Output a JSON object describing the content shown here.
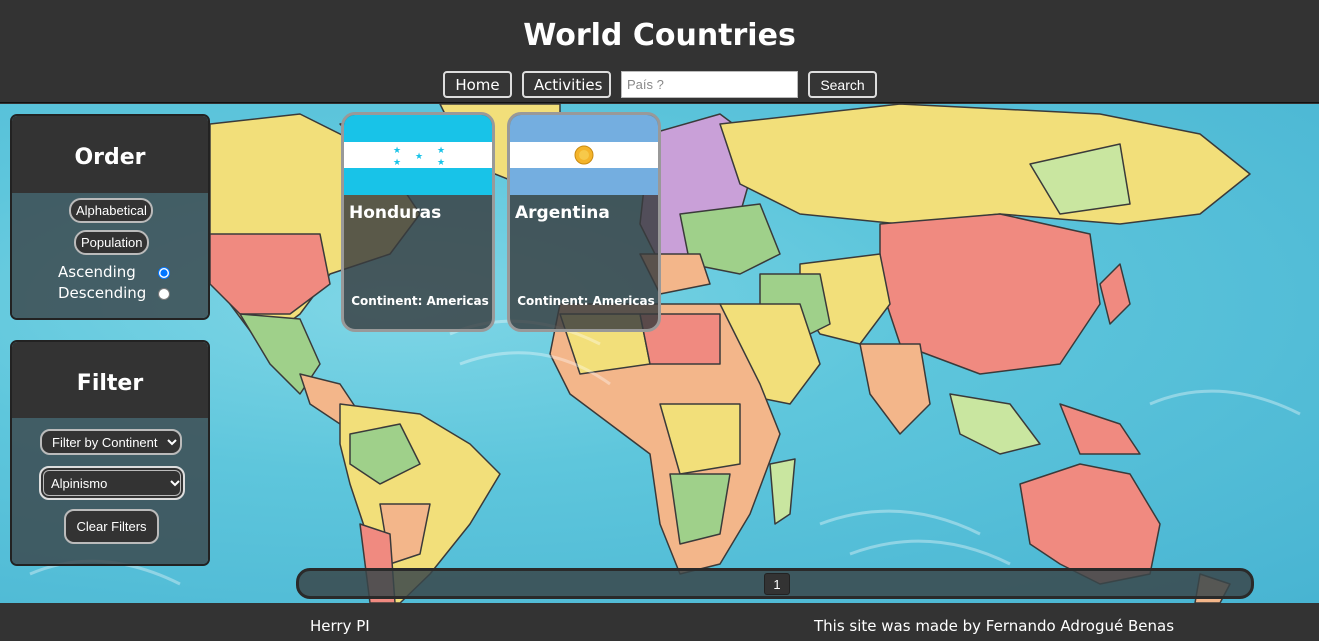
{
  "header": {
    "title": "World Countries",
    "nav": {
      "home_label": "Home",
      "activities_label": "Activities",
      "search_label": "Search"
    },
    "search": {
      "placeholder": "País ?",
      "value": ""
    }
  },
  "order_panel": {
    "title": "Order",
    "alphabetical_label": "Alphabetical",
    "population_label": "Population",
    "ascending_label": "Ascending",
    "descending_label": "Descending",
    "selected_direction": "Ascending"
  },
  "filter_panel": {
    "title": "Filter",
    "continent_selected": "Filter by Continent",
    "activity_selected": "Alpinismo",
    "clear_label": "Clear Filters"
  },
  "cards": [
    {
      "name": "Honduras",
      "continent_label": "Continent:",
      "continent": "Americas",
      "flag": "honduras-flag"
    },
    {
      "name": "Argentina",
      "continent_label": "Continent:",
      "continent": "Americas",
      "flag": "argentina-flag"
    }
  ],
  "pagination": {
    "current_page": "1"
  },
  "footer": {
    "left": "Herry PI",
    "right": "This site was made by Fernando Adrogué Benas"
  },
  "colors": {
    "header_bg": "#333333",
    "ocean": "#5ec6dc",
    "land_yellow": "#f2df7a",
    "land_red": "#f08a80",
    "land_green": "#9fd08a"
  }
}
